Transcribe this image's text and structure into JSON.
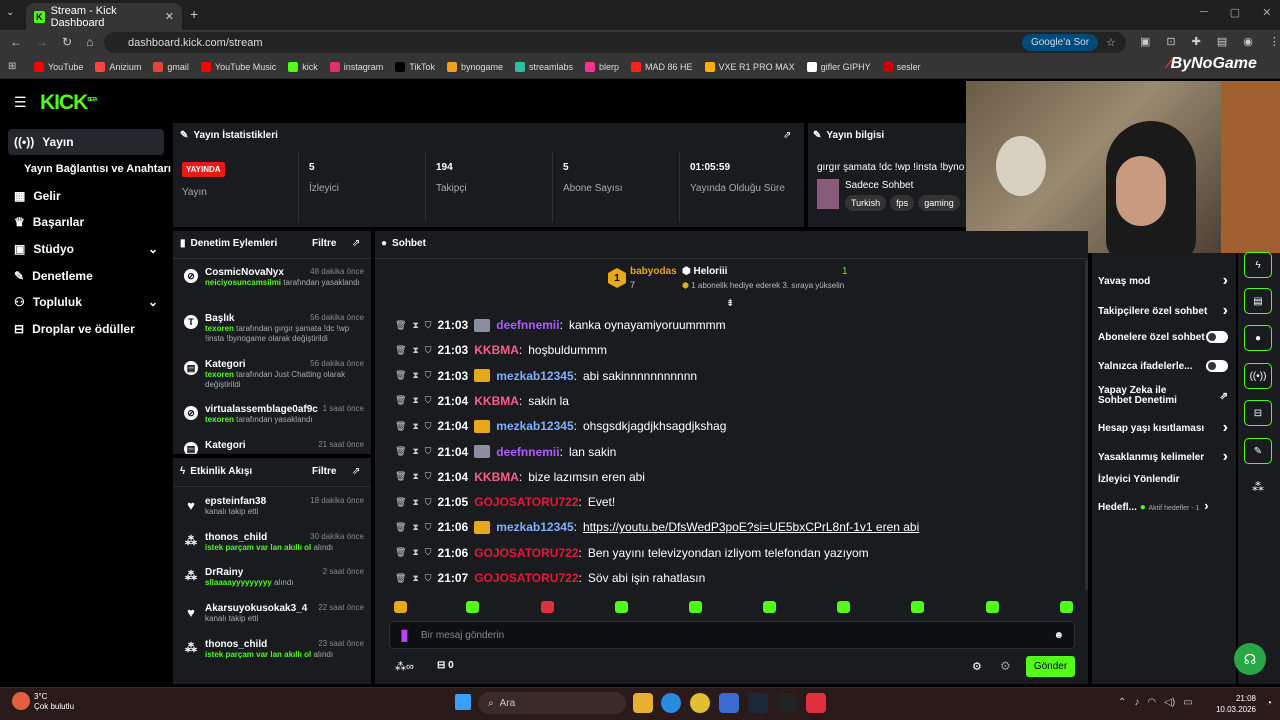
{
  "browser": {
    "tab_title": "Stream - Kick Dashboard",
    "url": "dashboard.kick.com/stream",
    "google_btn": "Google'a Sor",
    "bookmarks": [
      "YouTube",
      "Anizium",
      "gmail",
      "YouTube Music",
      "kick",
      "instagram",
      "TikTok",
      "bynogame",
      "streamlabs",
      "blerp",
      "MAD 86 HE",
      "VXE R1 PRO MAX",
      "gifler GIPHY",
      "sesler"
    ],
    "bookmark_colors": [
      "#ff0000",
      "#ff4444",
      "#ea4335",
      "#ff0000",
      "#53fc18",
      "#e1306c",
      "#000000",
      "#f0a020",
      "#30c0a0",
      "#ff3090",
      "#ff2020",
      "#ffb000",
      "#ffffff",
      "#cc0000"
    ]
  },
  "overlay": {
    "watermark": "ByNoGame"
  },
  "sidebar": {
    "items": [
      "Yayın",
      "Yayın Bağlantısı ve Anahtarı",
      "Gelir",
      "Başarılar",
      "Stüdyo",
      "Denetleme",
      "Topluluk",
      "Droplar ve ödüller"
    ]
  },
  "stats": {
    "title": "Yayın İstatistikleri",
    "live_badge": "YAYINDA",
    "live_label": "Yayın",
    "items": [
      {
        "value": "5",
        "label": "İzleyici"
      },
      {
        "value": "194",
        "label": "Takipçi"
      },
      {
        "value": "5",
        "label": "Abone Sayısı"
      },
      {
        "value": "01:05:59",
        "label": "Yayında Olduğu Süre"
      }
    ]
  },
  "info": {
    "title": "Yayın bilgisi",
    "stream_title": "gırgır şamata !dc !wp !insta !byno",
    "category": "Sadece Sohbet",
    "tags": [
      "Turkish",
      "fps",
      "gaming"
    ]
  },
  "modactions": {
    "title": "Denetim Eylemleri",
    "filter": "Filtre",
    "items": [
      {
        "user": "CosmicNovaNyx",
        "time": "48 dakika önce",
        "actor": "neiciyosuncamsilmi",
        "desc": "tarafından yasaklandı",
        "icon": "ban-icon"
      },
      {
        "user": "Başlık",
        "time": "56 dakika önce",
        "actor": "texoren",
        "desc": "tarafından gırgır şamata !dc !wp !insta !bynogame olarak değiştirildi",
        "icon": "title-icon"
      },
      {
        "user": "Kategori",
        "time": "56 dakika önce",
        "actor": "texoren",
        "desc": "tarafından Just Chatting olarak değiştirildi",
        "icon": "category-icon"
      },
      {
        "user": "virtualassemblage0af9c",
        "time": "1 saat önce",
        "actor": "texoren",
        "desc": "tarafından yasaklandı",
        "icon": "ban-icon"
      },
      {
        "user": "Kategori",
        "time": "21 saat önce",
        "actor": "",
        "desc": "",
        "icon": "category-icon"
      }
    ]
  },
  "activity": {
    "title": "Etkinlik Akışı",
    "filter": "Filtre",
    "items": [
      {
        "user": "epsteinfan38",
        "time": "18 dakika önce",
        "highlight": "",
        "desc": "kanalı takip etti",
        "icon": "heart-icon"
      },
      {
        "user": "thonos_child",
        "time": "30 dakika önce",
        "highlight": "istek parçam var lan akıllı ol",
        "desc": "alındı",
        "icon": "redeem-icon"
      },
      {
        "user": "DrRainy",
        "time": "2 saat önce",
        "highlight": "sllaaaayyyyyyyyy",
        "desc": "alındı",
        "icon": "redeem-icon"
      },
      {
        "user": "Akarsuyokusokak3_4",
        "time": "22 saat önce",
        "highlight": "",
        "desc": "kanalı takip etti",
        "icon": "heart-icon"
      },
      {
        "user": "thonos_child",
        "time": "23 saat önce",
        "highlight": "istek parçam var lan akıllı ol",
        "desc": "alındı",
        "icon": "redeem-icon"
      }
    ]
  },
  "chat": {
    "title": "Sohbet",
    "pinned_user1": "babyodas",
    "pinned_count1": "7",
    "pinned_user2": "Heloriii",
    "pinned_count2": "1",
    "pinned_text": "1 abonelik hediye ederek 3. sıraya yükselin",
    "messages": [
      {
        "time": "21:03",
        "user": "deefnnemii",
        "color": "#b05cff",
        "text": "kanka oynayamiyoruummmm",
        "badge": "avatar"
      },
      {
        "time": "21:03",
        "user": "KKBMA",
        "color": "#ff5c8a",
        "text": "hoşbuldummm",
        "badge": ""
      },
      {
        "time": "21:03",
        "user": "mezkab12345",
        "color": "#7fb0ff",
        "text": "abi sakinnnnnnnnnnn",
        "badge": "crown"
      },
      {
        "time": "21:04",
        "user": "KKBMA",
        "color": "#ff5c8a",
        "text": "sakin la",
        "badge": ""
      },
      {
        "time": "21:04",
        "user": "mezkab12345",
        "color": "#7fb0ff",
        "text": "ohsgsdkjagdjkhsagdjkshag",
        "badge": "crown"
      },
      {
        "time": "21:04",
        "user": "deefnnemii",
        "color": "#b05cff",
        "text": "lan sakin",
        "badge": "avatar"
      },
      {
        "time": "21:04",
        "user": "KKBMA",
        "color": "#ff5c8a",
        "text": "bize lazımsın eren abi",
        "badge": ""
      },
      {
        "time": "21:05",
        "user": "GOJOSATORU722",
        "color": "#e8173a",
        "text": "Evet!",
        "badge": ""
      },
      {
        "time": "21:06",
        "user": "mezkab12345",
        "color": "#7fb0ff",
        "text": "https://youtu.be/DfsWedP3poE?si=UE5bxCPrL8nf-1v1 eren abi",
        "badge": "crown"
      },
      {
        "time": "21:06",
        "user": "GOJOSATORU722",
        "color": "#e8173a",
        "text": "Ben yayını televizyondan izliyom telefondan yazıyom",
        "badge": ""
      },
      {
        "time": "21:07",
        "user": "GOJOSATORU722",
        "color": "#e8173a",
        "text": "Söv abi işin rahatlasın",
        "badge": ""
      }
    ],
    "input_placeholder": "Bir mesaj gönderin",
    "points": "0",
    "send": "Gönder"
  },
  "settings": {
    "items": [
      {
        "label": "Yavaş mod",
        "control": "arrow"
      },
      {
        "label": "Takipçilere özel sohbet",
        "control": "arrow"
      },
      {
        "label": "Abonelere özel sohbet",
        "control": "toggle"
      },
      {
        "label": "Yalnızca ifadelerle...",
        "control": "toggle"
      },
      {
        "label": "Yapay Zeka ile Sohbet Denetimi",
        "control": "link"
      },
      {
        "label": "Hesap yaşı kısıtlaması",
        "control": "arrow"
      },
      {
        "label": "Yasaklanmış kelimeler",
        "control": "arrow"
      },
      {
        "label": "İzleyici Yönlendir",
        "control": "none"
      },
      {
        "label": "Hedefl...",
        "control": "arrow"
      }
    ],
    "goal_status": "Aktif hedefler - 1"
  },
  "taskbar": {
    "weather_temp": "3°C",
    "weather_desc": "Çok bulutlu",
    "search": "Ara",
    "time": "21:08",
    "date": "10.03.2026"
  }
}
